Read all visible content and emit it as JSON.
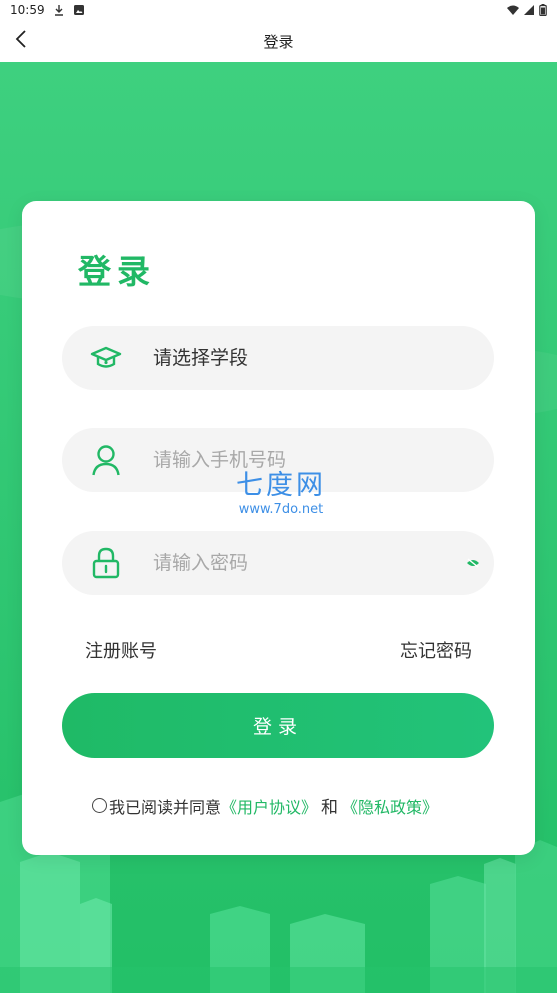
{
  "status_bar": {
    "time": "10:59",
    "left_icons": [
      "download-icon",
      "image-icon"
    ],
    "right_icons": [
      "wifi-icon",
      "signal-icon",
      "battery-icon"
    ]
  },
  "title_bar": {
    "title": "登录",
    "back_icon": "chevron-left-icon"
  },
  "card": {
    "heading": "登录",
    "stage_select": {
      "label": "请选择学段",
      "icon": "graduation-cap-icon"
    },
    "phone_input": {
      "placeholder": "请输入手机号码",
      "value": "",
      "icon": "user-icon"
    },
    "password_input": {
      "placeholder": "请输入密码",
      "value": "",
      "icon": "lock-icon",
      "toggle_icon": "eye-closed-icon"
    },
    "register_link": "注册账号",
    "forgot_link": "忘记密码",
    "login_button": "登录",
    "agreement": {
      "prefix": "我已阅读并同意",
      "user_agreement": "《用户协议》",
      "and": "和",
      "privacy_policy": "《隐私政策》",
      "checked": false
    }
  },
  "watermark": {
    "main": "七度网",
    "sub": "www.7do.net"
  },
  "colors": {
    "brand_green": "#21b865",
    "bg_green": "#2fc672",
    "watermark_blue": "#3d8fe6"
  }
}
